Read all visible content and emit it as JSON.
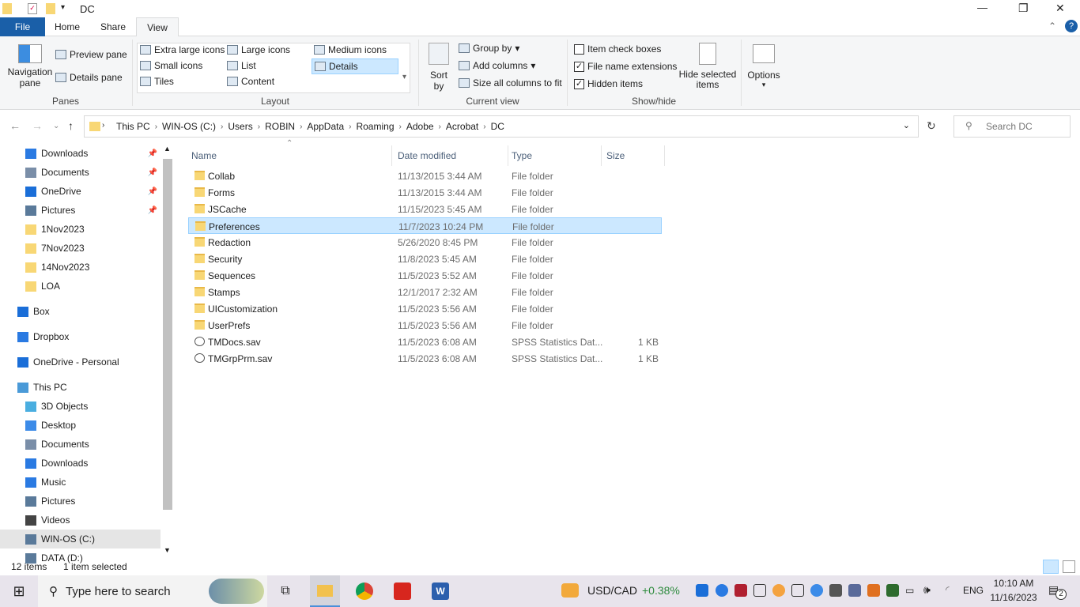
{
  "window": {
    "title": "DC",
    "minimize": "—",
    "maximize": "❐",
    "close": "✕"
  },
  "tabs": [
    {
      "label": "File"
    },
    {
      "label": "Home"
    },
    {
      "label": "Share"
    },
    {
      "label": "View"
    }
  ],
  "ribbon": {
    "panes": {
      "label": "Panes",
      "navigation_pane": "Navigation pane",
      "preview_pane": "Preview pane",
      "details_pane": "Details pane"
    },
    "layout": {
      "label": "Layout",
      "items": [
        "Extra large icons",
        "Large icons",
        "Medium icons",
        "Small icons",
        "List",
        "Details",
        "Tiles",
        "Content"
      ],
      "selected": "Details"
    },
    "current_view": {
      "label": "Current view",
      "sort_by": "Sort by",
      "group_by": "Group by",
      "add_columns": "Add columns",
      "size_all": "Size all columns to fit"
    },
    "show_hide": {
      "label": "Show/hide",
      "item_check_boxes": "Item check boxes",
      "file_name_extensions": "File name extensions",
      "hidden_items": "Hidden items",
      "hide_selected": "Hide selected items",
      "checked": [
        false,
        true,
        true
      ]
    },
    "options": "Options"
  },
  "address": {
    "crumbs": [
      "This PC",
      "WIN-OS (C:)",
      "Users",
      "ROBIN",
      "AppData",
      "Roaming",
      "Adobe",
      "Acrobat",
      "DC"
    ],
    "search_placeholder": "Search DC"
  },
  "nav": [
    {
      "label": "Downloads",
      "pin": true
    },
    {
      "label": "Documents",
      "pin": true
    },
    {
      "label": "OneDrive",
      "pin": true
    },
    {
      "label": "Pictures",
      "pin": true
    },
    {
      "label": "1Nov2023"
    },
    {
      "label": "7Nov2023"
    },
    {
      "label": "14Nov2023"
    },
    {
      "label": "LOA"
    },
    {
      "label": "Box"
    },
    {
      "label": "Dropbox"
    },
    {
      "label": "OneDrive - Personal"
    },
    {
      "label": "This PC"
    },
    {
      "label": "3D Objects"
    },
    {
      "label": "Desktop"
    },
    {
      "label": "Documents"
    },
    {
      "label": "Downloads"
    },
    {
      "label": "Music"
    },
    {
      "label": "Pictures"
    },
    {
      "label": "Videos"
    },
    {
      "label": "WIN-OS (C:)"
    },
    {
      "label": "DATA (D:)"
    }
  ],
  "columns": [
    "Name",
    "Date modified",
    "Type",
    "Size"
  ],
  "files": [
    {
      "name": "Collab",
      "date": "11/13/2015 3:44 AM",
      "type": "File folder",
      "size": ""
    },
    {
      "name": "Forms",
      "date": "11/13/2015 3:44 AM",
      "type": "File folder",
      "size": ""
    },
    {
      "name": "JSCache",
      "date": "11/15/2023 5:45 AM",
      "type": "File folder",
      "size": ""
    },
    {
      "name": "Preferences",
      "date": "11/7/2023 10:24 PM",
      "type": "File folder",
      "size": ""
    },
    {
      "name": "Redaction",
      "date": "5/26/2020 8:45 PM",
      "type": "File folder",
      "size": ""
    },
    {
      "name": "Security",
      "date": "11/8/2023 5:45 AM",
      "type": "File folder",
      "size": ""
    },
    {
      "name": "Sequences",
      "date": "11/5/2023 5:52 AM",
      "type": "File folder",
      "size": ""
    },
    {
      "name": "Stamps",
      "date": "12/1/2017 2:32 AM",
      "type": "File folder",
      "size": ""
    },
    {
      "name": "UICustomization",
      "date": "11/5/2023 5:56 AM",
      "type": "File folder",
      "size": ""
    },
    {
      "name": "UserPrefs",
      "date": "11/5/2023 5:56 AM",
      "type": "File folder",
      "size": ""
    },
    {
      "name": "TMDocs.sav",
      "date": "11/5/2023 6:08 AM",
      "type": "SPSS Statistics Dat...",
      "size": "1 KB"
    },
    {
      "name": "TMGrpPrm.sav",
      "date": "11/5/2023 6:08 AM",
      "type": "SPSS Statistics Dat...",
      "size": "1 KB"
    }
  ],
  "status": {
    "count": "12 items",
    "selected": "1 item selected"
  },
  "taskbar": {
    "search": "Type here to search",
    "ticker": "USD/CAD",
    "change": "+0.38%",
    "lang": "ENG",
    "time": "10:10 AM",
    "date": "11/16/2023",
    "notifications": "2"
  }
}
